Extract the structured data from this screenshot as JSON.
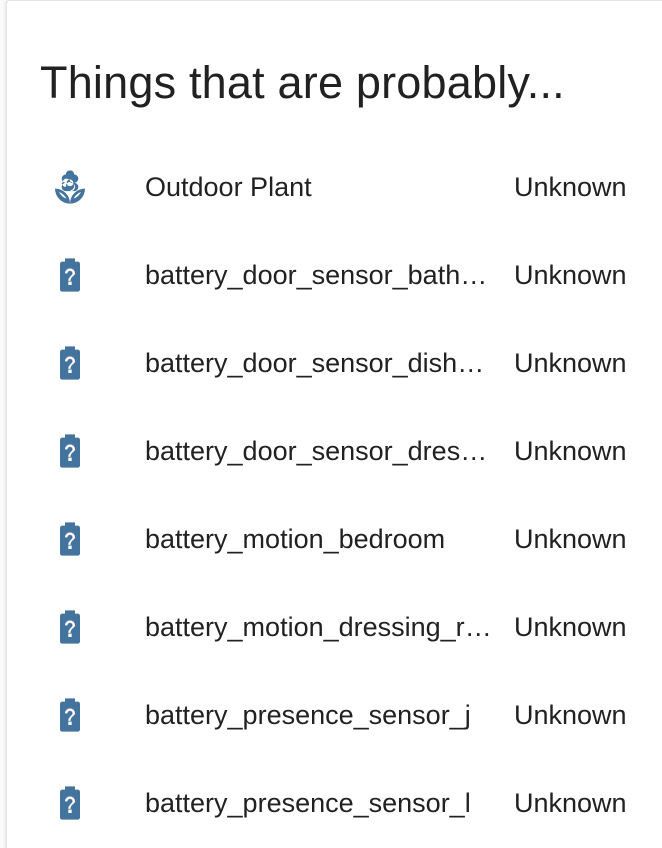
{
  "card": {
    "title": "Things that are probably..."
  },
  "colors": {
    "icon": "#44739e",
    "text": "#212121"
  },
  "entities": [
    {
      "icon": "flower-icon",
      "name": "Outdoor Plant",
      "state": "Unknown"
    },
    {
      "icon": "battery-unknown-icon",
      "name": "battery_door_sensor_bathroom",
      "state": "Unknown"
    },
    {
      "icon": "battery-unknown-icon",
      "name": "battery_door_sensor_dishwasher",
      "state": "Unknown"
    },
    {
      "icon": "battery-unknown-icon",
      "name": "battery_door_sensor_dressing_room",
      "state": "Unknown"
    },
    {
      "icon": "battery-unknown-icon",
      "name": "battery_motion_bedroom",
      "state": "Unknown"
    },
    {
      "icon": "battery-unknown-icon",
      "name": "battery_motion_dressing_room",
      "state": "Unknown"
    },
    {
      "icon": "battery-unknown-icon",
      "name": "battery_presence_sensor_j",
      "state": "Unknown"
    },
    {
      "icon": "battery-unknown-icon",
      "name": "battery_presence_sensor_l",
      "state": "Unknown"
    }
  ]
}
